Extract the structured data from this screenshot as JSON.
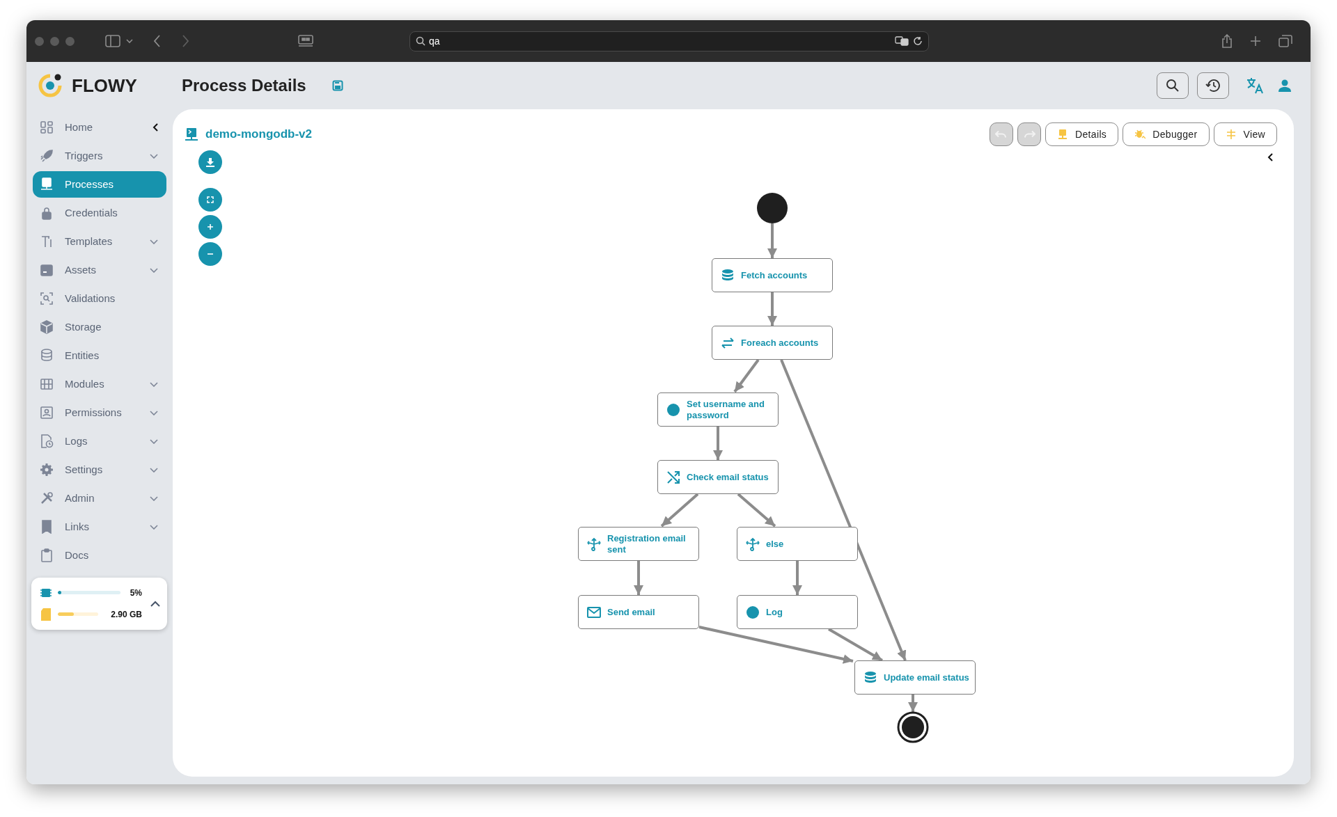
{
  "browser": {
    "address": "qa"
  },
  "app": {
    "brand": "FLOWY",
    "page_title": "Process Details"
  },
  "sidebar": {
    "items": [
      {
        "label": "Home",
        "expandable": false,
        "selected": false
      },
      {
        "label": "Triggers",
        "expandable": true,
        "selected": false
      },
      {
        "label": "Processes",
        "expandable": false,
        "selected": true
      },
      {
        "label": "Credentials",
        "expandable": false,
        "selected": false
      },
      {
        "label": "Templates",
        "expandable": true,
        "selected": false
      },
      {
        "label": "Assets",
        "expandable": true,
        "selected": false
      },
      {
        "label": "Validations",
        "expandable": false,
        "selected": false
      },
      {
        "label": "Storage",
        "expandable": false,
        "selected": false
      },
      {
        "label": "Entities",
        "expandable": false,
        "selected": false
      },
      {
        "label": "Modules",
        "expandable": true,
        "selected": false
      },
      {
        "label": "Permissions",
        "expandable": true,
        "selected": false
      },
      {
        "label": "Logs",
        "expandable": true,
        "selected": false
      },
      {
        "label": "Settings",
        "expandable": true,
        "selected": false
      },
      {
        "label": "Admin",
        "expandable": true,
        "selected": false
      },
      {
        "label": "Links",
        "expandable": true,
        "selected": false
      },
      {
        "label": "Docs",
        "expandable": false,
        "selected": false
      }
    ]
  },
  "resources": {
    "cpu": {
      "level": 0.05,
      "reading": "5%"
    },
    "storage": {
      "level": 0.4,
      "reading": "2.90 GB"
    }
  },
  "process": {
    "name": "demo-mongodb-v2",
    "undo": {
      "disabled": true
    },
    "redo": {
      "disabled": true
    },
    "toolbar": [
      {
        "label": "Details"
      },
      {
        "label": "Debugger"
      },
      {
        "label": "View"
      }
    ]
  },
  "diagram": {
    "nodes": [
      {
        "kind": "query",
        "label": "Fetch accounts"
      },
      {
        "kind": "loop",
        "label": "Foreach accounts"
      },
      {
        "kind": "script",
        "label": "Set username and password"
      },
      {
        "kind": "switch",
        "label": "Check email status"
      },
      {
        "kind": "case",
        "label": "Registration email sent"
      },
      {
        "kind": "case",
        "label": "else"
      },
      {
        "kind": "email",
        "label": "Send email"
      },
      {
        "kind": "script",
        "label": "Log"
      },
      {
        "kind": "query",
        "label": "Update email status"
      }
    ]
  }
}
